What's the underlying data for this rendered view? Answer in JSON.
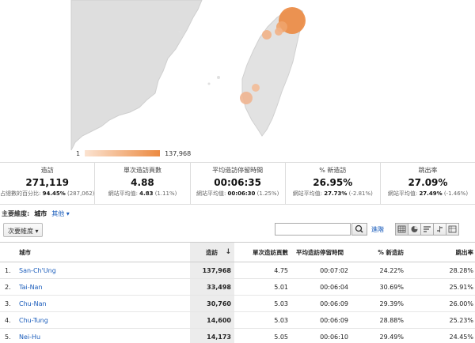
{
  "legend": {
    "min": "1",
    "max": "137,968"
  },
  "metrics": [
    {
      "label": "造訪",
      "value": "271,119",
      "sub_label": "占總數的百分比:",
      "sub_bold": "94.45%",
      "sub_rest": "(287,062)"
    },
    {
      "label": "單次造訪頁數",
      "value": "4.88",
      "sub_label": "網站平均值:",
      "sub_bold": "4.83",
      "sub_rest": "(1.11%)"
    },
    {
      "label": "平均造訪停留時間",
      "value": "00:06:35",
      "sub_label": "網站平均值:",
      "sub_bold": "00:06:30",
      "sub_rest": "(1.25%)"
    },
    {
      "label": "% 新造訪",
      "value": "26.95%",
      "sub_label": "網站平均值:",
      "sub_bold": "27.73%",
      "sub_rest": "(-2.81%)"
    },
    {
      "label": "跳出率",
      "value": "27.09%",
      "sub_label": "網站平均值:",
      "sub_bold": "27.49%",
      "sub_rest": "(-1.46%)"
    }
  ],
  "dimension": {
    "label": "主要維度:",
    "value": "城市",
    "other": "其他"
  },
  "toolbar": {
    "secondary": "次要維度",
    "advanced": "進階"
  },
  "table": {
    "headers": {
      "city": "城市",
      "visits": "造訪",
      "pages": "單次造訪頁數",
      "avg_time": "平均造訪停留時間",
      "new_visits": "% 新造訪",
      "bounce": "跳出率"
    },
    "rows": [
      {
        "n": "1.",
        "city": "San-Ch'Ung",
        "visits": "137,968",
        "pages": "4.75",
        "avg_time": "00:07:02",
        "new_visits": "24.22%",
        "bounce": "28.28%"
      },
      {
        "n": "2.",
        "city": "Tai-Nan",
        "visits": "33,498",
        "pages": "5.01",
        "avg_time": "00:06:04",
        "new_visits": "30.69%",
        "bounce": "25.91%"
      },
      {
        "n": "3.",
        "city": "Chu-Nan",
        "visits": "30,760",
        "pages": "5.03",
        "avg_time": "00:06:09",
        "new_visits": "29.39%",
        "bounce": "26.00%"
      },
      {
        "n": "4.",
        "city": "Chu-Tung",
        "visits": "14,600",
        "pages": "5.03",
        "avg_time": "00:06:09",
        "new_visits": "28.88%",
        "bounce": "25.23%"
      },
      {
        "n": "5.",
        "city": "Nei-Hu",
        "visits": "14,173",
        "pages": "5.05",
        "avg_time": "00:06:10",
        "new_visits": "29.49%",
        "bounce": "24.45%"
      }
    ]
  }
}
